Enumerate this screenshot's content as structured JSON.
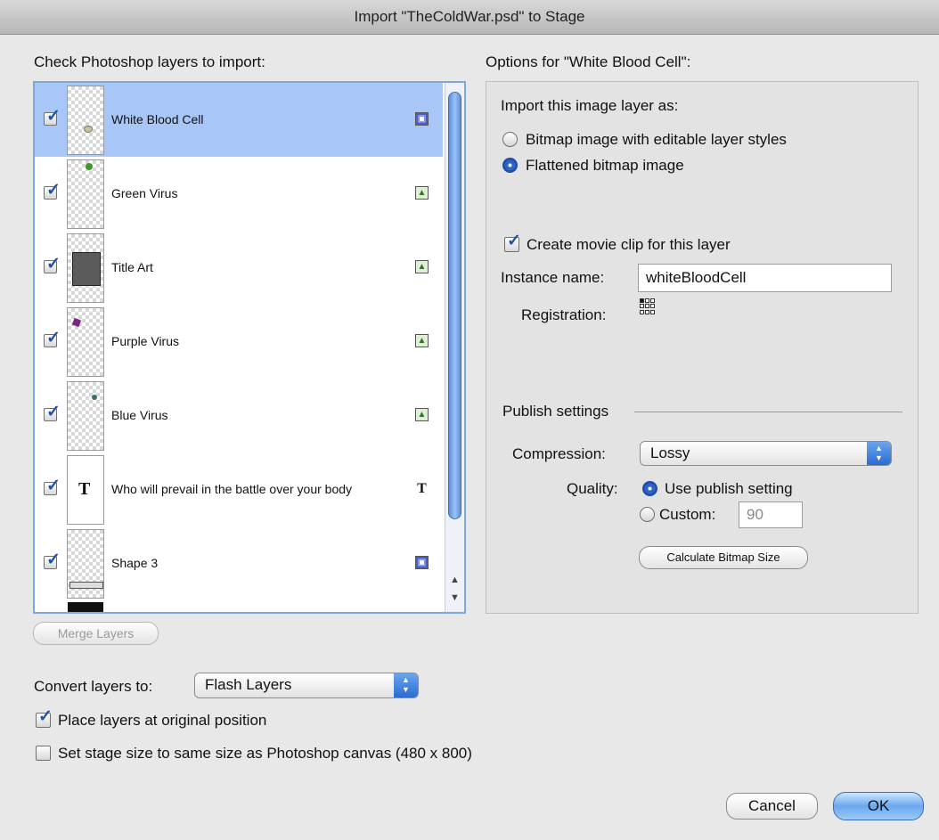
{
  "window": {
    "title": "Import \"TheColdWar.psd\" to Stage"
  },
  "left": {
    "heading": "Check Photoshop layers to import:",
    "layers": [
      {
        "name": "White Blood Cell",
        "checked": true,
        "selected": true,
        "type_icon": "shape-icon"
      },
      {
        "name": "Green Virus",
        "checked": true,
        "selected": false,
        "type_icon": "bitmap-icon"
      },
      {
        "name": "Title Art",
        "checked": true,
        "selected": false,
        "type_icon": "bitmap-icon"
      },
      {
        "name": "Purple Virus",
        "checked": true,
        "selected": false,
        "type_icon": "bitmap-icon"
      },
      {
        "name": "Blue Virus",
        "checked": true,
        "selected": false,
        "type_icon": "bitmap-icon"
      },
      {
        "name": "Who will prevail in the battle over your body",
        "checked": true,
        "selected": false,
        "type_icon": "text-icon"
      },
      {
        "name": "Shape 3",
        "checked": true,
        "selected": false,
        "type_icon": "shape-icon"
      }
    ],
    "merge_button": "Merge Layers"
  },
  "right": {
    "heading": "Options for \"White Blood Cell\":",
    "import_as_label": "Import this image layer as:",
    "radio_bitmap_editable": "Bitmap image with editable layer styles",
    "radio_flattened": "Flattened bitmap image",
    "create_movie_clip": "Create movie clip for this layer",
    "instance_name_label": "Instance name:",
    "instance_name_value": "whiteBloodCell",
    "registration_label": "Registration:",
    "publish_settings_label": "Publish settings",
    "compression_label": "Compression:",
    "compression_value": "Lossy",
    "quality_label": "Quality:",
    "quality_publish": "Use publish setting",
    "quality_custom": "Custom:",
    "quality_custom_value": "90",
    "calc_button": "Calculate Bitmap Size"
  },
  "bottom": {
    "convert_label": "Convert layers to:",
    "convert_value": "Flash Layers",
    "place_original": "Place layers at original position",
    "set_stage_size": "Set stage size to same size as Photoshop canvas (480 x 800)",
    "cancel": "Cancel",
    "ok": "OK"
  },
  "symbols": {
    "check": "✓",
    "stepper": "▲▼",
    "text_glyph": "T",
    "arrow_up": "▲",
    "arrow_down": "▼"
  },
  "colors": {
    "selection": "#a8c7f8",
    "accent": "#2c64c7"
  }
}
